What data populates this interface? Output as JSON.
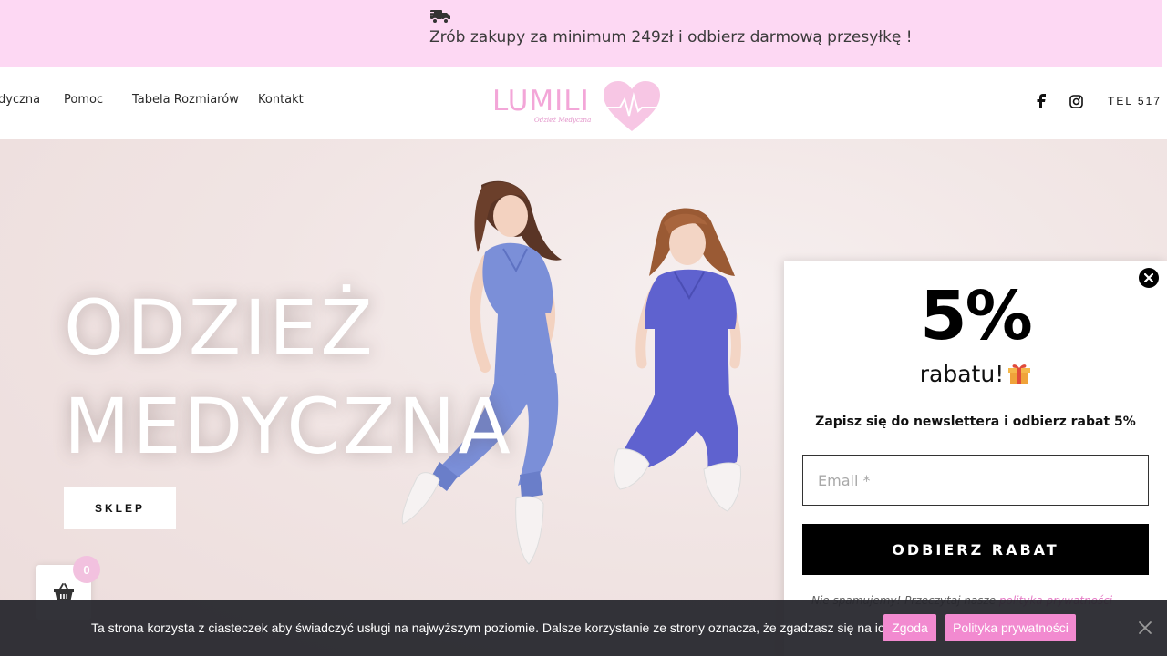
{
  "promo": {
    "icon": "truck-icon",
    "text": "Zrób zakupy za minimum 249zł i odbierz darmową przesyłkę !"
  },
  "nav": {
    "items": [
      "dyczna",
      "Pomoc",
      "Tabela Rozmiarów",
      "Kontakt"
    ]
  },
  "logo": {
    "word": "LUMILI",
    "tagline": "Odzież Medyczna"
  },
  "header_right": {
    "icons": [
      "facebook-icon",
      "instagram-icon"
    ],
    "tel": "TEL 517"
  },
  "hero": {
    "title_line1": "ODZIEŻ",
    "title_line2": "MEDYCZNA",
    "button": "SKLEP"
  },
  "popup": {
    "percent": "5%",
    "rabatu": "rabatu!",
    "description": "Zapisz się do newslettera i odbierz rabat 5%",
    "email_placeholder": "Email *",
    "submit": "ODBIERZ RABAT",
    "fine_print": "Nie spamujemy! Przeczytaj nasze ",
    "fine_link": "polityka prywatności"
  },
  "cart": {
    "count": "0"
  },
  "cookie": {
    "message": "Ta strona korzysta z ciasteczek aby świadczyć usługi na najwyższym poziomie. Dalsze korzystanie ze strony oznacza, że zgadzasz się na ich użycie.",
    "accept": "Zgoda",
    "policy": "Polityka prywatności"
  },
  "colors": {
    "promo_bg": "#fdd8f3",
    "brand_pink": "#f3a6d8",
    "cookie_button": "#f28ad0",
    "scrub_blue": "#7b8fd8",
    "scrub_indigo": "#5f62cf"
  }
}
